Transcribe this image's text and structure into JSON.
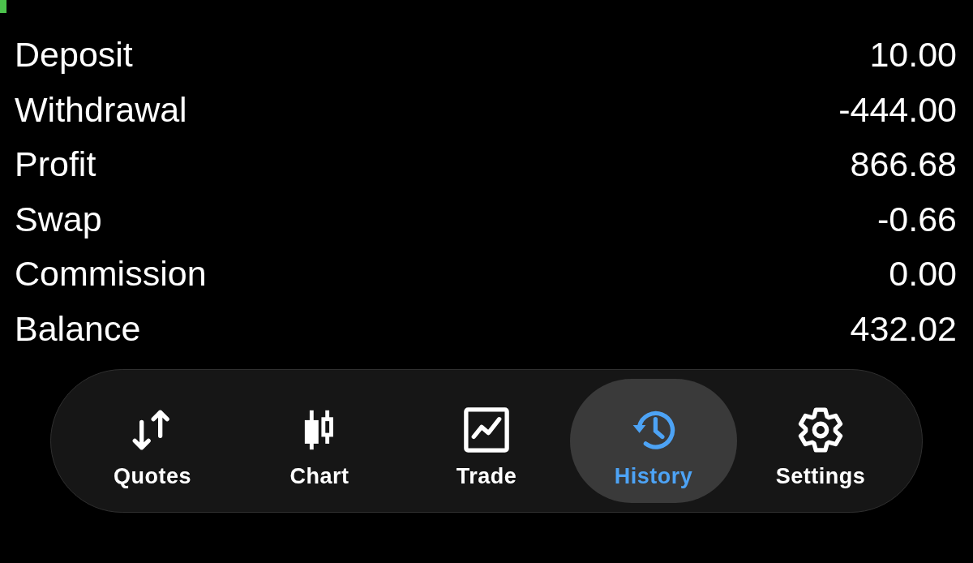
{
  "rows": [
    {
      "label": "Deposit",
      "value": "10.00"
    },
    {
      "label": "Withdrawal",
      "value": "-444.00"
    },
    {
      "label": "Profit",
      "value": "866.68"
    },
    {
      "label": "Swap",
      "value": "-0.66"
    },
    {
      "label": "Commission",
      "value": "0.00"
    },
    {
      "label": "Balance",
      "value": "432.02"
    }
  ],
  "tab_bar": {
    "tabs": [
      {
        "label": "Quotes",
        "kind": "quotes",
        "selected": false
      },
      {
        "label": "Chart",
        "kind": "chart",
        "selected": false
      },
      {
        "label": "Trade",
        "kind": "trade",
        "selected": false
      },
      {
        "label": "History",
        "kind": "history",
        "selected": true
      },
      {
        "label": "Settings",
        "kind": "settings",
        "selected": false
      }
    ]
  }
}
